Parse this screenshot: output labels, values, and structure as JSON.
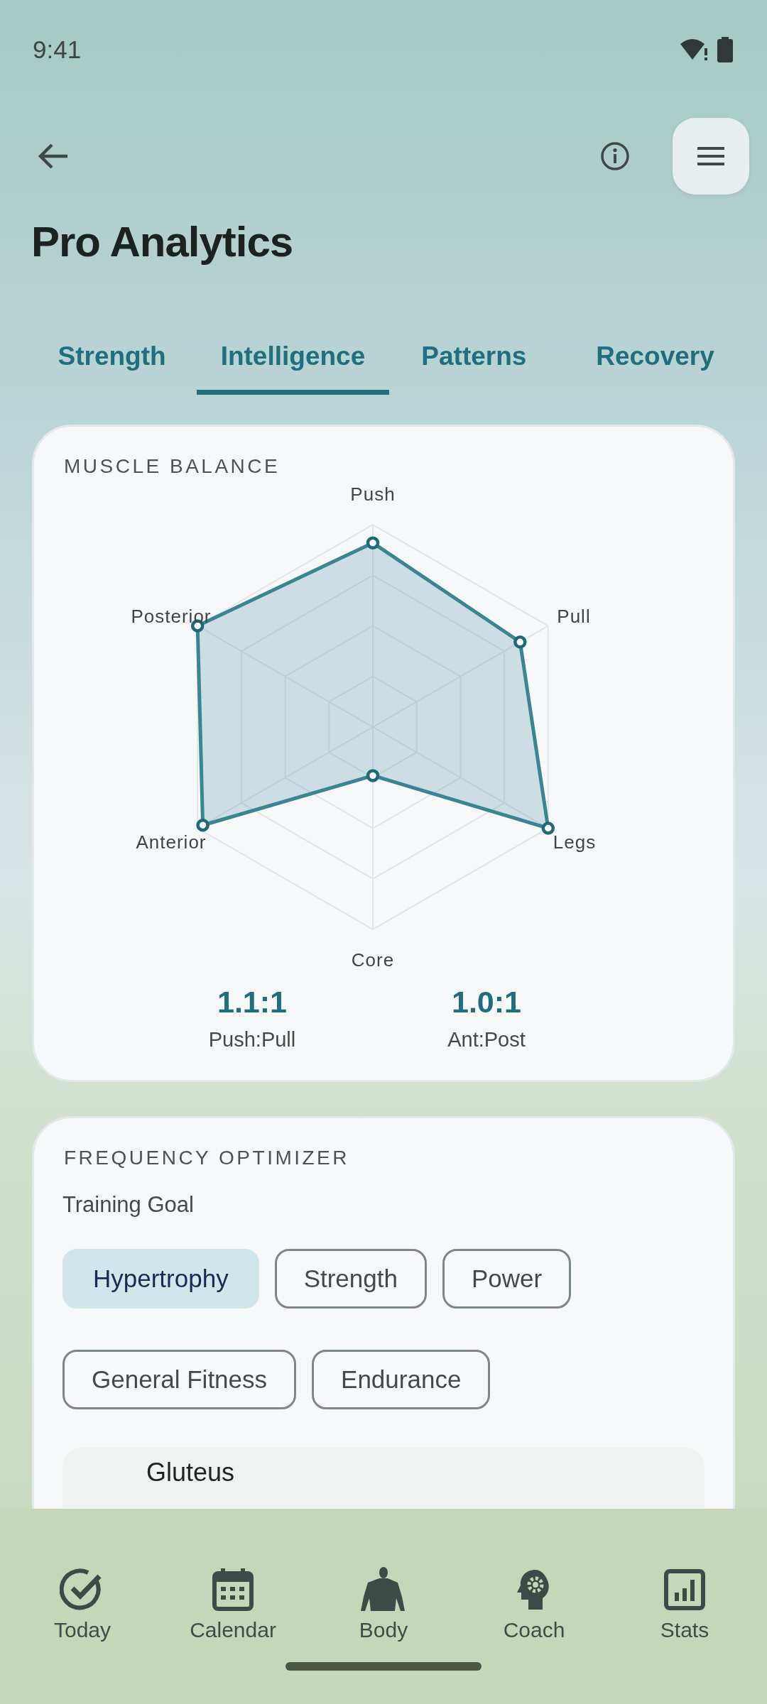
{
  "status_bar": {
    "time": "9:41"
  },
  "header": {
    "title": "Pro Analytics"
  },
  "tabs": [
    {
      "label": "Strength",
      "selected": false
    },
    {
      "label": "Intelligence",
      "selected": true
    },
    {
      "label": "Patterns",
      "selected": false
    },
    {
      "label": "Recovery",
      "selected": false
    }
  ],
  "muscle_balance": {
    "title": "MUSCLE BALANCE",
    "axes": [
      "Push",
      "Pull",
      "Legs",
      "Core",
      "Anterior",
      "Posterior"
    ],
    "ratios": [
      {
        "value": "1.1:1",
        "label": "Push:Pull"
      },
      {
        "value": "1.0:1",
        "label": "Ant:Post"
      }
    ]
  },
  "frequency_optimizer": {
    "title": "FREQUENCY OPTIMIZER",
    "goal_label": "Training Goal",
    "goals": [
      {
        "label": "Hypertrophy",
        "selected": true
      },
      {
        "label": "Strength",
        "selected": false
      },
      {
        "label": "Power",
        "selected": false
      },
      {
        "label": "General Fitness",
        "selected": false
      },
      {
        "label": "Endurance",
        "selected": false
      }
    ],
    "muscle": "Gluteus"
  },
  "nav": [
    {
      "label": "Today",
      "kind": "check"
    },
    {
      "label": "Calendar",
      "kind": "calendar"
    },
    {
      "label": "Body",
      "kind": "body"
    },
    {
      "label": "Coach",
      "kind": "coach"
    },
    {
      "label": "Stats",
      "kind": "stats"
    }
  ]
}
